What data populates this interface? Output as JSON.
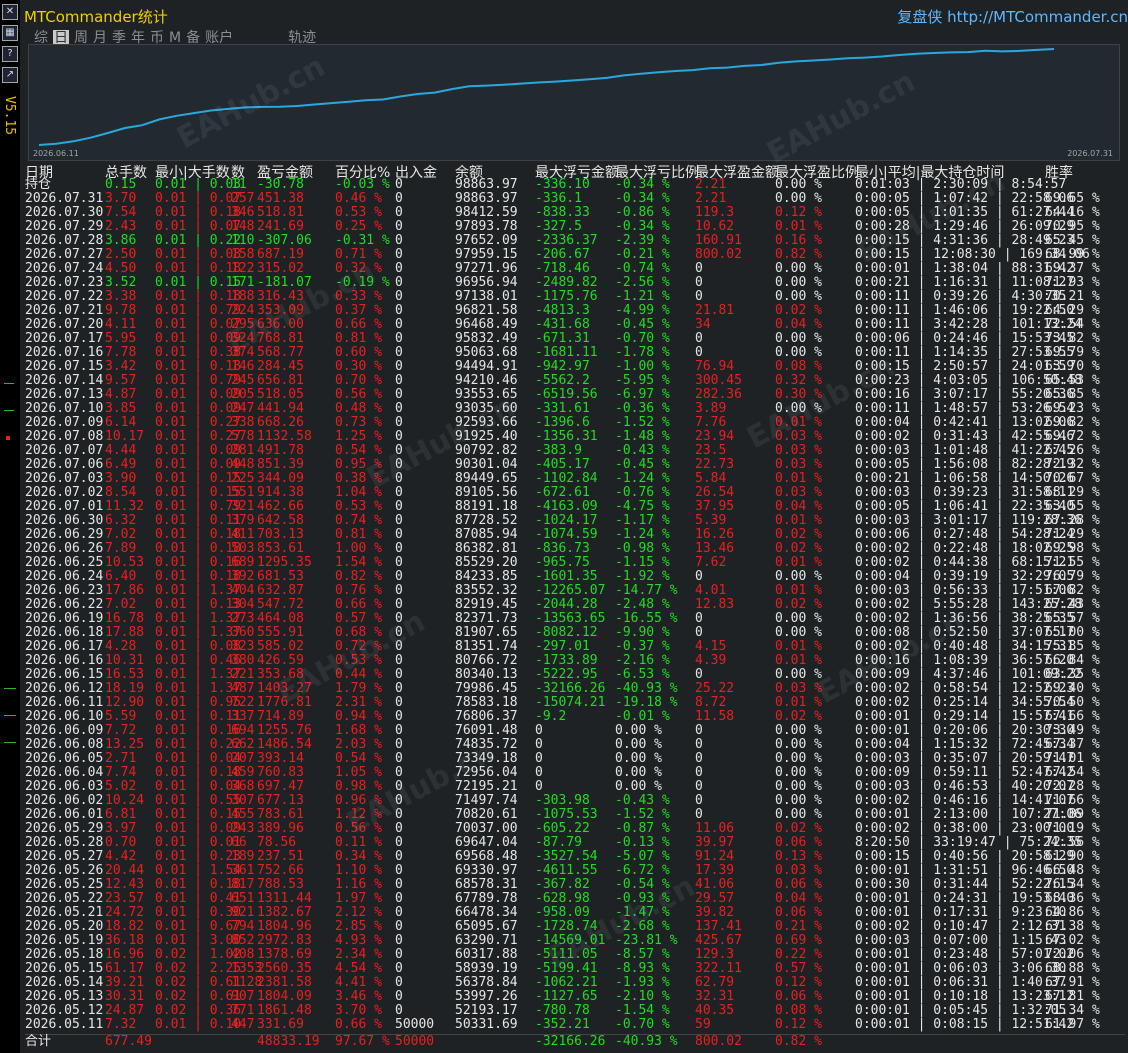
{
  "window": {
    "title": "MTCommander统计",
    "site": "复盘侠 http://MTCommander.cn",
    "version": "V5.15",
    "tabs": [
      "综",
      "日",
      "周",
      "月",
      "季",
      "年",
      "币",
      "M",
      "备",
      "账户",
      "轨迹"
    ],
    "active_tab": "日"
  },
  "colors": {
    "green": "#22dd22",
    "red": "#e82020",
    "white": "#e6e6e6",
    "curve": "#29a8e0",
    "accent": "#f0d000"
  },
  "icons": [
    "close-icon",
    "grid-icon",
    "help-icon",
    "chart-icon"
  ],
  "watermark": "EAHub.cn",
  "chart": {
    "start_label": "2026.06.11",
    "end_label": "2026.07.31"
  },
  "chart_data": {
    "type": "line",
    "title": "",
    "x_start": "2026.06.11",
    "x_end": "2026.07.31",
    "series": [
      {
        "name": "",
        "values": [
          50331,
          51000,
          52193,
          53997,
          56378,
          58939,
          60317,
          63290,
          65095,
          66478,
          67789,
          68578,
          69330,
          69568,
          69647,
          70037,
          70820,
          71497,
          72195,
          72956,
          73349,
          74835,
          76091,
          76806,
          78583,
          79986,
          80340,
          80766,
          81351,
          81907,
          82371,
          82919,
          83552,
          84233,
          85529,
          86382,
          87085,
          87728,
          88191,
          89105,
          89449,
          90301,
          90792,
          91925,
          92593,
          93035,
          93553,
          94210,
          94494,
          95063,
          95832,
          96468,
          96821,
          97138,
          97271,
          97959,
          97652,
          97893,
          98412,
          98863
        ]
      }
    ]
  },
  "columns": [
    "日期",
    "总手数",
    "最小|大手数",
    "数",
    "盈亏金额",
    "百分比%",
    "出入金",
    "余额",
    "最大浮亏金额",
    "最大浮亏比例",
    "最大浮盈金额",
    "最大浮盈比例",
    "最小|平均|最大持仓时间",
    "胜率"
  ],
  "rows": [
    [
      "持仓",
      "0.15",
      "0.01 | 0.03",
      "11",
      "-30.78",
      "-0.03 %",
      "0",
      "98863.97",
      "-336.10",
      "-0.34 %",
      "2.21",
      "0.00 %",
      "0:01:03 | 2:30:09 | 8:54:57",
      ""
    ],
    [
      "2026.07.31",
      "3.70",
      "0.01 | 0.07",
      "257",
      "451.38",
      "0.46 %",
      "0",
      "98863.97",
      "-336.1",
      "-0.34 %",
      "2.21",
      "0.00 %",
      "0:00:05 | 1:07:42 | 22:58:06",
      "69.65 %"
    ],
    [
      "2026.07.30",
      "7.54",
      "0.01 | 0.18",
      "346",
      "518.81",
      "0.53 %",
      "0",
      "98412.59",
      "-838.33",
      "-0.86 %",
      "119.3",
      "0.12 %",
      "0:00:05 | 1:01:35 | 61:27:44",
      "64.16 %"
    ],
    [
      "2026.07.29",
      "2.43",
      "0.01 | 0.07",
      "148",
      "241.69",
      "0.25 %",
      "0",
      "97893.78",
      "-327.5",
      "-0.34 %",
      "10.62",
      "0.01 %",
      "0:00:28 | 1:29:46 | 26:09:29",
      "70.95 %"
    ],
    [
      "2026.07.28",
      "3.86",
      "0.01 | 0.22",
      "110",
      "-307.06",
      "-0.31 %",
      "0",
      "97652.09",
      "-2336.37",
      "-2.39 %",
      "160.91",
      "0.16 %",
      "0:00:15 | 4:31:36 | 28:49:23",
      "65.45 %"
    ],
    [
      "2026.07.27",
      "2.50",
      "0.01 | 0.08",
      "158",
      "687.19",
      "0.71 %",
      "0",
      "97959.15",
      "-206.67",
      "-0.21 %",
      "800.02",
      "0.82 %",
      "0:00:15 | 12:08:30 | 169:34:06",
      "68.99 %"
    ],
    [
      "2026.07.24",
      "4.50",
      "0.01 | 0.18",
      "122",
      "315.02",
      "0.32 %",
      "0",
      "97271.96",
      "-718.46",
      "-0.74 %",
      "0",
      "0.00 %",
      "0:00:01 | 1:38:04 | 88:31:42",
      "69.37 %"
    ],
    [
      "2026.07.23",
      "3.52",
      "0.01 | 0.15",
      "171",
      "-181.07",
      "-0.19 %",
      "0",
      "96956.94",
      "-2489.82",
      "-2.56 %",
      "0",
      "0.00 %",
      "0:00:21 | 1:16:31 | 11:08:27",
      "71.93 %"
    ],
    [
      "2026.07.22",
      "3.38",
      "0.01 | 0.18",
      "188",
      "316.43",
      "0.33 %",
      "0",
      "97138.01",
      "-1175.76",
      "-1.21 %",
      "0",
      "0.00 %",
      "0:00:11 | 0:39:26 | 4:30:35",
      "70.21 %"
    ],
    [
      "2026.07.21",
      "9.78",
      "0.01 | 0.79",
      "224",
      "353.09",
      "0.37 %",
      "0",
      "96821.58",
      "-4813.3",
      "-4.99 %",
      "21.81",
      "0.02 %",
      "0:00:11 | 1:46:06 | 19:22:50",
      "64.29 %"
    ],
    [
      "2026.07.20",
      "4.11",
      "0.01 | 0.07",
      "295",
      "636.00",
      "0.66 %",
      "0",
      "96468.49",
      "-431.68",
      "-0.45 %",
      "34",
      "0.04 %",
      "0:00:11 | 3:42:28 | 101:13:24",
      "72.54 %"
    ],
    [
      "2026.07.17",
      "5.95",
      "0.01 | 0.09",
      "324",
      "768.81",
      "0.81 %",
      "0",
      "95832.49",
      "-671.31",
      "-0.70 %",
      "0",
      "0.00 %",
      "0:00:06 | 0:24:46 | 15:53:45",
      "73.82 %"
    ],
    [
      "2026.07.16",
      "7.78",
      "0.01 | 0.38",
      "374",
      "568.77",
      "0.60 %",
      "0",
      "95063.68",
      "-1681.11",
      "-1.78 %",
      "0",
      "0.00 %",
      "0:00:11 | 1:14:35 | 27:53:55",
      "69.79 %"
    ],
    [
      "2026.07.15",
      "3.42",
      "0.01 | 0.18",
      "146",
      "284.45",
      "0.30 %",
      "0",
      "94494.91",
      "-942.97",
      "-1.00 %",
      "76.94",
      "0.08 %",
      "0:00:15 | 2:50:57 | 24:01:59",
      "63.70 %"
    ],
    [
      "2026.07.14",
      "9.57",
      "0.01 | 0.79",
      "245",
      "656.81",
      "0.70 %",
      "0",
      "94210.46",
      "-5562.2",
      "-5.95 %",
      "300.45",
      "0.32 %",
      "0:00:23 | 4:03:05 | 106:50:48",
      "65.53 %"
    ],
    [
      "2026.07.13",
      "4.87",
      "0.01 | 0.09",
      "205",
      "518.05",
      "0.56 %",
      "0",
      "93553.65",
      "-6519.56",
      "-6.97 %",
      "282.36",
      "0.30 %",
      "0:00:16 | 3:07:17 | 55:20:36",
      "65.85 %"
    ],
    [
      "2026.07.10",
      "3.85",
      "0.01 | 0.09",
      "247",
      "441.94",
      "0.48 %",
      "0",
      "93035.60",
      "-331.61",
      "-0.36 %",
      "3.89",
      "0.00 %",
      "0:00:11 | 1:48:57 | 53:26:54",
      "69.23 %"
    ],
    [
      "2026.07.09",
      "6.14",
      "0.01 | 0.27",
      "338",
      "668.26",
      "0.73 %",
      "0",
      "92593.66",
      "-1396.6",
      "-1.52 %",
      "7.76",
      "0.01 %",
      "0:00:04 | 0:42:41 | 13:02:06",
      "69.82 %"
    ],
    [
      "2026.07.08",
      "10.17",
      "0.01 | 0.27",
      "578",
      "1132.58",
      "1.25 %",
      "0",
      "91925.40",
      "-1356.31",
      "-1.48 %",
      "23.94",
      "0.03 %",
      "0:00:02 | 0:31:43 | 42:55:46",
      "69.72 %"
    ],
    [
      "2026.07.07",
      "4.44",
      "0.01 | 0.09",
      "281",
      "491.78",
      "0.54 %",
      "0",
      "90792.82",
      "-383.9",
      "-0.43 %",
      "23.5",
      "0.03 %",
      "0:00:03 | 1:01:48 | 41:22:45",
      "67.26 %"
    ],
    [
      "2026.07.06",
      "6.49",
      "0.01 | 0.09",
      "448",
      "851.39",
      "0.95 %",
      "0",
      "90301.04",
      "-405.17",
      "-0.45 %",
      "22.73",
      "0.03 %",
      "0:00:05 | 1:56:08 | 82:28:19",
      "72.32 %"
    ],
    [
      "2026.07.03",
      "3.90",
      "0.01 | 0.15",
      "225",
      "344.09",
      "0.38 %",
      "0",
      "89449.65",
      "-1102.84",
      "-1.24 %",
      "5.84",
      "0.01 %",
      "0:00:21 | 1:06:58 | 14:50:26",
      "70.67 %"
    ],
    [
      "2026.07.02",
      "8.54",
      "0.01 | 0.15",
      "551",
      "914.38",
      "1.04 %",
      "0",
      "89105.56",
      "-672.61",
      "-0.76 %",
      "26.54",
      "0.03 %",
      "0:00:03 | 0:39:23 | 31:58:11",
      "68.29 %"
    ],
    [
      "2026.07.01",
      "11.32",
      "0.01 | 0.79",
      "321",
      "462.66",
      "0.53 %",
      "0",
      "88191.18",
      "-4163.09",
      "-4.75 %",
      "37.95",
      "0.04 %",
      "0:00:05 | 1:06:41 | 22:35:40",
      "63.55 %"
    ],
    [
      "2026.06.30",
      "6.32",
      "0.01 | 0.11",
      "379",
      "642.58",
      "0.74 %",
      "0",
      "87728.52",
      "-1024.17",
      "-1.17 %",
      "5.39",
      "0.01 %",
      "0:00:03 | 3:01:17 | 119:28:36",
      "67.28 %"
    ],
    [
      "2026.06.29",
      "7.02",
      "0.01 | 0.18",
      "411",
      "703.13",
      "0.81 %",
      "0",
      "87085.94",
      "-1074.59",
      "-1.24 %",
      "16.26",
      "0.02 %",
      "0:00:06 | 0:27:48 | 54:28:24",
      "71.29 %"
    ],
    [
      "2026.06.26",
      "7.89",
      "0.01 | 0.18",
      "503",
      "853.61",
      "1.00 %",
      "0",
      "86382.81",
      "-836.73",
      "-0.98 %",
      "13.46",
      "0.02 %",
      "0:00:02 | 0:22:48 | 18:02:25",
      "69.98 %"
    ],
    [
      "2026.06.25",
      "10.53",
      "0.01 | 0.16",
      "689",
      "1295.35",
      "1.54 %",
      "0",
      "85529.20",
      "-965.75",
      "-1.15 %",
      "7.62",
      "0.01 %",
      "0:00:02 | 0:44:38 | 68:15:21",
      "71.55 %"
    ],
    [
      "2026.06.24",
      "6.40",
      "0.01 | 0.18",
      "392",
      "681.53",
      "0.82 %",
      "0",
      "84233.85",
      "-1601.35",
      "-1.92 %",
      "0",
      "0.00 %",
      "0:00:04 | 0:39:19 | 32:29:05",
      "76.79 %"
    ],
    [
      "2026.06.23",
      "17.86",
      "0.01 | 1.37",
      "404",
      "632.87",
      "0.76 %",
      "0",
      "83552.32",
      "-12265.07",
      "-14.77 %",
      "4.01",
      "0.01 %",
      "0:00:03 | 0:56:33 | 17:51:06",
      "67.82 %"
    ],
    [
      "2026.06.22",
      "7.02",
      "0.01 | 0.13",
      "304",
      "547.72",
      "0.66 %",
      "0",
      "82919.45",
      "-2044.28",
      "-2.48 %",
      "12.83",
      "0.02 %",
      "0:00:02 | 5:55:28 | 143:25:28",
      "67.43 %"
    ],
    [
      "2026.06.19",
      "16.78",
      "0.01 | 1.37",
      "273",
      "464.08",
      "0.57 %",
      "0",
      "82371.73",
      "-13563.65",
      "-16.55 %",
      "0",
      "0.00 %",
      "0:00:02 | 1:36:56 | 38:25:35",
      "65.57 %"
    ],
    [
      "2026.06.18",
      "17.88",
      "0.01 | 1.37",
      "360",
      "555.91",
      "0.68 %",
      "0",
      "81907.65",
      "-8082.12",
      "-9.90 %",
      "0",
      "0.00 %",
      "0:00:08 | 0:52:50 | 37:07:17",
      "65.00 %"
    ],
    [
      "2026.06.17",
      "4.28",
      "0.01 | 0.08",
      "323",
      "585.02",
      "0.72 %",
      "0",
      "81351.74",
      "-297.01",
      "-0.37 %",
      "4.15",
      "0.01 %",
      "0:00:02 | 0:40:48 | 34:15:31",
      "75.85 %"
    ],
    [
      "2026.06.16",
      "10.31",
      "0.01 | 0.46",
      "380",
      "426.59",
      "0.53 %",
      "0",
      "80766.72",
      "-1733.89",
      "-2.16 %",
      "4.39",
      "0.01 %",
      "0:00:16 | 1:08:39 | 36:57:20",
      "66.84 %"
    ],
    [
      "2026.06.15",
      "16.53",
      "0.01 | 1.37",
      "221",
      "353.68",
      "0.44 %",
      "0",
      "80340.13",
      "-5222.95",
      "-6.53 %",
      "0",
      "0.00 %",
      "0:00:09 | 4:37:46 | 101:09:22",
      "63.35 %"
    ],
    [
      "2026.06.12",
      "18.19",
      "0.01 | 1.37",
      "487",
      "1403.27",
      "1.79 %",
      "0",
      "79986.45",
      "-32166.26",
      "-40.93 %",
      "25.22",
      "0.03 %",
      "0:00:02 | 0:58:54 | 12:52:23",
      "69.40 %"
    ],
    [
      "2026.06.11",
      "12.90",
      "0.01 | 0.95",
      "722",
      "1776.81",
      "2.31 %",
      "0",
      "78583.18",
      "-15074.21",
      "-19.18 %",
      "8.72",
      "0.01 %",
      "0:00:02 | 0:25:14 | 34:55:54",
      "70.50 %"
    ],
    [
      "2026.06.10",
      "5.59",
      "0.01 | 0.11",
      "337",
      "714.89",
      "0.94 %",
      "0",
      "76806.37",
      "-9.2",
      "-0.01 %",
      "11.58",
      "0.02 %",
      "0:00:01 | 0:29:14 | 15:57:41",
      "67.66 %"
    ],
    [
      "2026.06.09",
      "7.72",
      "0.01 | 0.16",
      "694",
      "1255.76",
      "1.68 %",
      "0",
      "76091.48",
      "0",
      "0.00 %",
      "0",
      "0.00 %",
      "0:00:01 | 0:20:06 | 20:30:30",
      "73.49 %"
    ],
    [
      "2026.06.08",
      "13.25",
      "0.01 | 0.22",
      "662",
      "1486.54",
      "2.03 %",
      "0",
      "74835.72",
      "0",
      "0.00 %",
      "0",
      "0.00 %",
      "0:00:04 | 1:15:32 | 72:45:34",
      "67.37 %"
    ],
    [
      "2026.06.05",
      "2.71",
      "0.01 | 0.04",
      "207",
      "393.14",
      "0.54 %",
      "0",
      "73349.18",
      "0",
      "0.00 %",
      "0",
      "0.00 %",
      "0:00:03 | 0:35:07 | 20:59:47",
      "71.01 %"
    ],
    [
      "2026.06.04",
      "7.74",
      "0.01 | 0.18",
      "459",
      "760.83",
      "1.05 %",
      "0",
      "72956.04",
      "0",
      "0.00 %",
      "0",
      "0.00 %",
      "0:00:09 | 0:59:11 | 52:47:42",
      "67.54 %"
    ],
    [
      "2026.06.03",
      "5.02",
      "0.01 | 0.04",
      "368",
      "697.47",
      "0.98 %",
      "0",
      "72195.21",
      "0",
      "0.00 %",
      "0",
      "0.00 %",
      "0:00:03 | 0:46:53 | 40:20:07",
      "72.28 %"
    ],
    [
      "2026.06.02",
      "10.24",
      "0.01 | 0.55",
      "307",
      "677.13",
      "0.96 %",
      "0",
      "71497.74",
      "-303.98",
      "-0.43 %",
      "0",
      "0.00 %",
      "0:00:02 | 0:46:16 | 14:41:07",
      "71.66 %"
    ],
    [
      "2026.06.01",
      "6.81",
      "0.01 | 0.15",
      "455",
      "783.61",
      "1.12 %",
      "0",
      "70820.61",
      "-1075.53",
      "-1.52 %",
      "0",
      "0.00 %",
      "0:00:01 | 2:13:00 | 107:27:06",
      "71.89 %"
    ],
    [
      "2026.05.29",
      "3.97",
      "0.01 | 0.09",
      "243",
      "389.96",
      "0.56 %",
      "0",
      "70037.00",
      "-605.22",
      "-0.87 %",
      "11.06",
      "0.02 %",
      "0:00:02 | 0:38:00 | 23:00:00",
      "71.19 %"
    ],
    [
      "2026.05.28",
      "0.70",
      "0.01 | 0.01",
      "66",
      "78.56",
      "0.11 %",
      "0",
      "69647.04",
      "-87.79",
      "-0.13 %",
      "39.97",
      "0.06 %",
      "8:20:50 | 33:19:47 | 75:24:35",
      "72.56 %"
    ],
    [
      "2026.05.27",
      "4.42",
      "0.01 | 0.23",
      "189",
      "237.51",
      "0.34 %",
      "0",
      "69568.48",
      "-3527.54",
      "-5.07 %",
      "91.24",
      "0.13 %",
      "0:00:15 | 0:40:56 | 20:58:29",
      "61.90 %"
    ],
    [
      "2026.05.26",
      "20.44",
      "0.01 | 1.54",
      "361",
      "752.66",
      "1.10 %",
      "0",
      "69330.97",
      "-4611.55",
      "-6.72 %",
      "17.39",
      "0.03 %",
      "0:00:01 | 1:31:51 | 96:46:50",
      "66.48 %"
    ],
    [
      "2026.05.25",
      "12.43",
      "0.01 | 0.18",
      "817",
      "788.53",
      "1.16 %",
      "0",
      "68578.31",
      "-367.82",
      "-0.54 %",
      "41.06",
      "0.06 %",
      "0:00:30 | 0:31:44 | 52:22:15",
      "76.34 %"
    ],
    [
      "2026.05.22",
      "23.57",
      "0.01 | 0.41",
      "651",
      "1311.44",
      "1.97 %",
      "0",
      "67789.78",
      "-628.98",
      "-0.93 %",
      "29.57",
      "0.04 %",
      "0:00:01 | 0:24:31 | 19:53:40",
      "68.36 %"
    ],
    [
      "2026.05.21",
      "24.72",
      "0.01 | 0.30",
      "921",
      "1382.67",
      "2.12 %",
      "0",
      "66478.34",
      "-958.09",
      "-1.47 %",
      "39.82",
      "0.06 %",
      "0:00:01 | 0:17:31 | 9:23:10",
      "64.86 %"
    ],
    [
      "2026.05.20",
      "18.82",
      "0.01 | 0.67",
      "794",
      "1804.96",
      "2.85 %",
      "0",
      "65095.67",
      "-1728.74",
      "-2.68 %",
      "137.41",
      "0.21 %",
      "0:00:02 | 0:10:47 | 2:12:31",
      "67.38 %"
    ],
    [
      "2026.05.19",
      "36.18",
      "0.01 | 3.00",
      "852",
      "2972.83",
      "4.93 %",
      "0",
      "63290.71",
      "-14569.01",
      "-23.81 %",
      "425.67",
      "0.69 %",
      "0:00:03 | 0:07:00 | 1:15:43",
      "67.02 %"
    ],
    [
      "2026.05.18",
      "16.96",
      "0.02 | 1.02",
      "408",
      "1378.69",
      "2.34 %",
      "0",
      "60317.88",
      "-5111.05",
      "-8.57 %",
      "129.3",
      "0.22 %",
      "0:00:01 | 0:23:48 | 57:01:02",
      "72.06 %"
    ],
    [
      "2026.05.15",
      "61.17",
      "0.02 | 2.25",
      "1353",
      "2560.35",
      "4.54 %",
      "0",
      "58939.19",
      "-5199.41",
      "-8.93 %",
      "322.11",
      "0.57 %",
      "0:00:01 | 0:06:03 | 3:06:30",
      "68.88 %"
    ],
    [
      "2026.05.14",
      "39.21",
      "0.02 | 0.61",
      "1128",
      "2381.58",
      "4.41 %",
      "0",
      "56378.84",
      "-1062.21",
      "-1.93 %",
      "62.79",
      "0.12 %",
      "0:00:01 | 0:06:31 | 1:40:37",
      "67.91 %"
    ],
    [
      "2026.05.13",
      "30.31",
      "0.02 | 0.61",
      "907",
      "1804.09",
      "3.46 %",
      "0",
      "53997.26",
      "-1127.65",
      "-2.10 %",
      "32.31",
      "0.06 %",
      "0:00:01 | 0:10:18 | 13:23:12",
      "67.81 %"
    ],
    [
      "2026.05.12",
      "24.87",
      "0.02 | 0.36",
      "771",
      "1861.48",
      "3.70 %",
      "0",
      "52193.17",
      "-780.78",
      "-1.54 %",
      "40.35",
      "0.08 %",
      "0:00:01 | 0:05:45 | 1:32:05",
      "71.34 %"
    ],
    [
      "2026.05.11",
      "7.32",
      "0.01 | 0.10",
      "447",
      "331.69",
      "0.66 %",
      "50000",
      "50331.69",
      "-352.21",
      "-0.70 %",
      "59",
      "0.12 %",
      "0:00:01 | 0:08:15 | 12:51:42",
      "61.97 %"
    ]
  ],
  "total": [
    "合计",
    "677.49",
    "",
    "",
    "48833.19",
    "97.67 %",
    "50000",
    "",
    "-32166.26",
    "-40.93 %",
    "800.02",
    "0.82 %",
    "",
    ""
  ]
}
